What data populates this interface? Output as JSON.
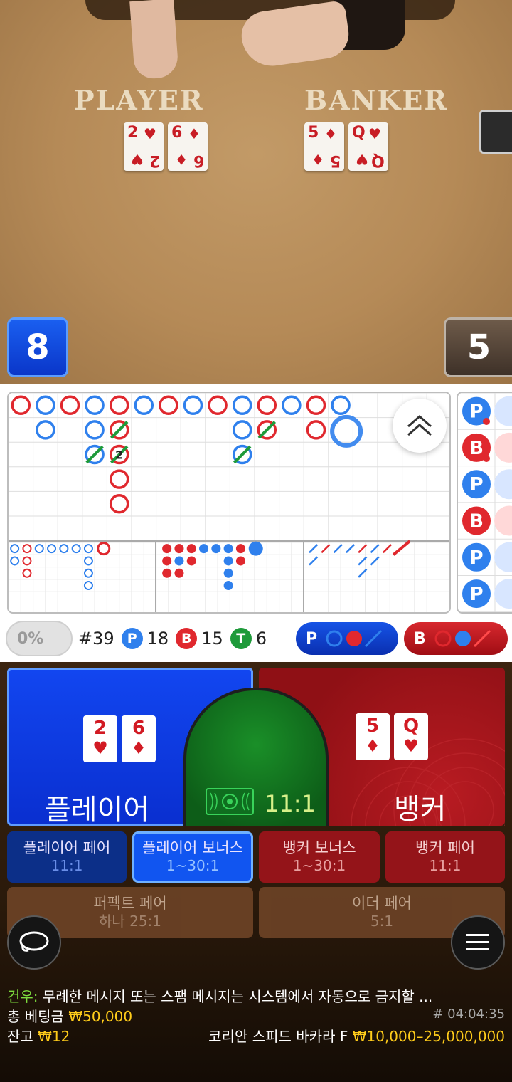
{
  "video": {
    "player_label": "PLAYER",
    "banker_label": "BANKER",
    "player_cards": [
      {
        "rank": "2",
        "suit": "♥"
      },
      {
        "rank": "6",
        "suit": "♦"
      }
    ],
    "banker_cards": [
      {
        "rank": "5",
        "suit": "♦"
      },
      {
        "rank": "Q",
        "suit": "♥"
      }
    ],
    "player_score": "8",
    "banker_score": "5"
  },
  "roadmap": {
    "big_road_tie_marker": "2",
    "side_bead_labels": [
      "P",
      "B",
      "P",
      "B",
      "P",
      "P"
    ],
    "colors": {
      "player": "#2f80ed",
      "banker": "#e0282e",
      "tie": "#1e9a3a"
    }
  },
  "stats": {
    "toggle_label": "0%",
    "round": "#39",
    "player_badge": "P",
    "player_count": "18",
    "banker_badge": "B",
    "banker_count": "15",
    "tie_badge": "T",
    "tie_count": "6",
    "predict_player": "P",
    "predict_banker": "B"
  },
  "bets": {
    "player_cards": [
      {
        "rank": "2",
        "suit": "♥"
      },
      {
        "rank": "6",
        "suit": "♦"
      }
    ],
    "banker_cards": [
      {
        "rank": "5",
        "suit": "♦"
      },
      {
        "rank": "Q",
        "suit": "♥"
      }
    ],
    "player_label": "플레이어",
    "banker_label": "뱅커",
    "tie_odds": "11:1",
    "side": [
      {
        "label": "플레이어 페어",
        "odds": "11:1"
      },
      {
        "label": "플레이어 보너스",
        "odds": "1~30:1"
      },
      {
        "label": "뱅커 보너스",
        "odds": "1~30:1"
      },
      {
        "label": "뱅커 페어",
        "odds": "11:1"
      },
      {
        "label": "퍼펙트 페어",
        "odds": "하나 25:1"
      },
      {
        "label": "이더 페어",
        "odds": "5:1"
      }
    ]
  },
  "chat": {
    "sender": "건우:",
    "message": " 무례한 메시지 또는 스팸 메시지는 시스템에서 자동으로 금지할 ..."
  },
  "footer": {
    "total_bet_label": "총 베팅금",
    "total_bet_value": "₩50,000",
    "balance_label": "잔고",
    "balance_value": "₩12",
    "game_id": "# 04:04:35",
    "table_name": "코리안 스피드 바카라 F",
    "table_limits": "₩10,000–25,000,000"
  }
}
